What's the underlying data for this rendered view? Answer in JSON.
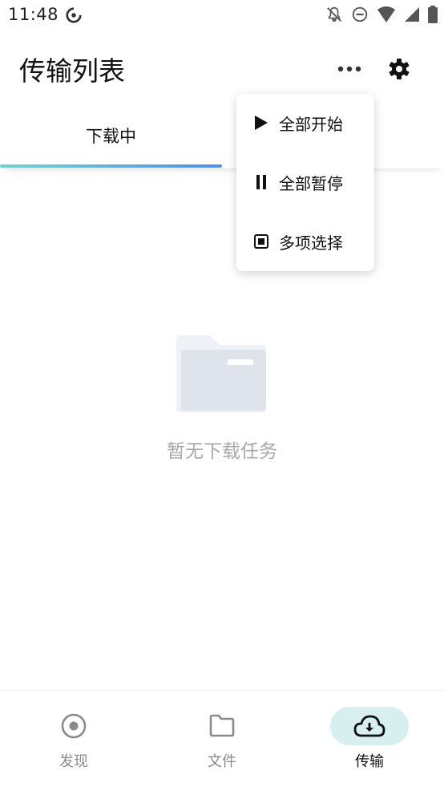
{
  "status_bar": {
    "time": "11:48"
  },
  "header": {
    "title": "传输列表"
  },
  "tabs": [
    {
      "label": "下载中",
      "active": true
    }
  ],
  "menu": {
    "items": [
      {
        "label": "全部开始",
        "icon": "play-icon"
      },
      {
        "label": "全部暂停",
        "icon": "pause-icon"
      },
      {
        "label": "多项选择",
        "icon": "checkbox-square-icon"
      }
    ]
  },
  "empty_state": {
    "text": "暂无下载任务"
  },
  "bottom_nav": {
    "items": [
      {
        "label": "发现",
        "icon": "discover-icon"
      },
      {
        "label": "文件",
        "icon": "folder-icon"
      },
      {
        "label": "传输",
        "icon": "cloud-download-icon",
        "active": true
      }
    ]
  },
  "colors": {
    "accent_gradient_start": "#6fd3d1",
    "accent_gradient_end": "#4f8fe6",
    "active_nav_bg": "#d8eff0"
  }
}
